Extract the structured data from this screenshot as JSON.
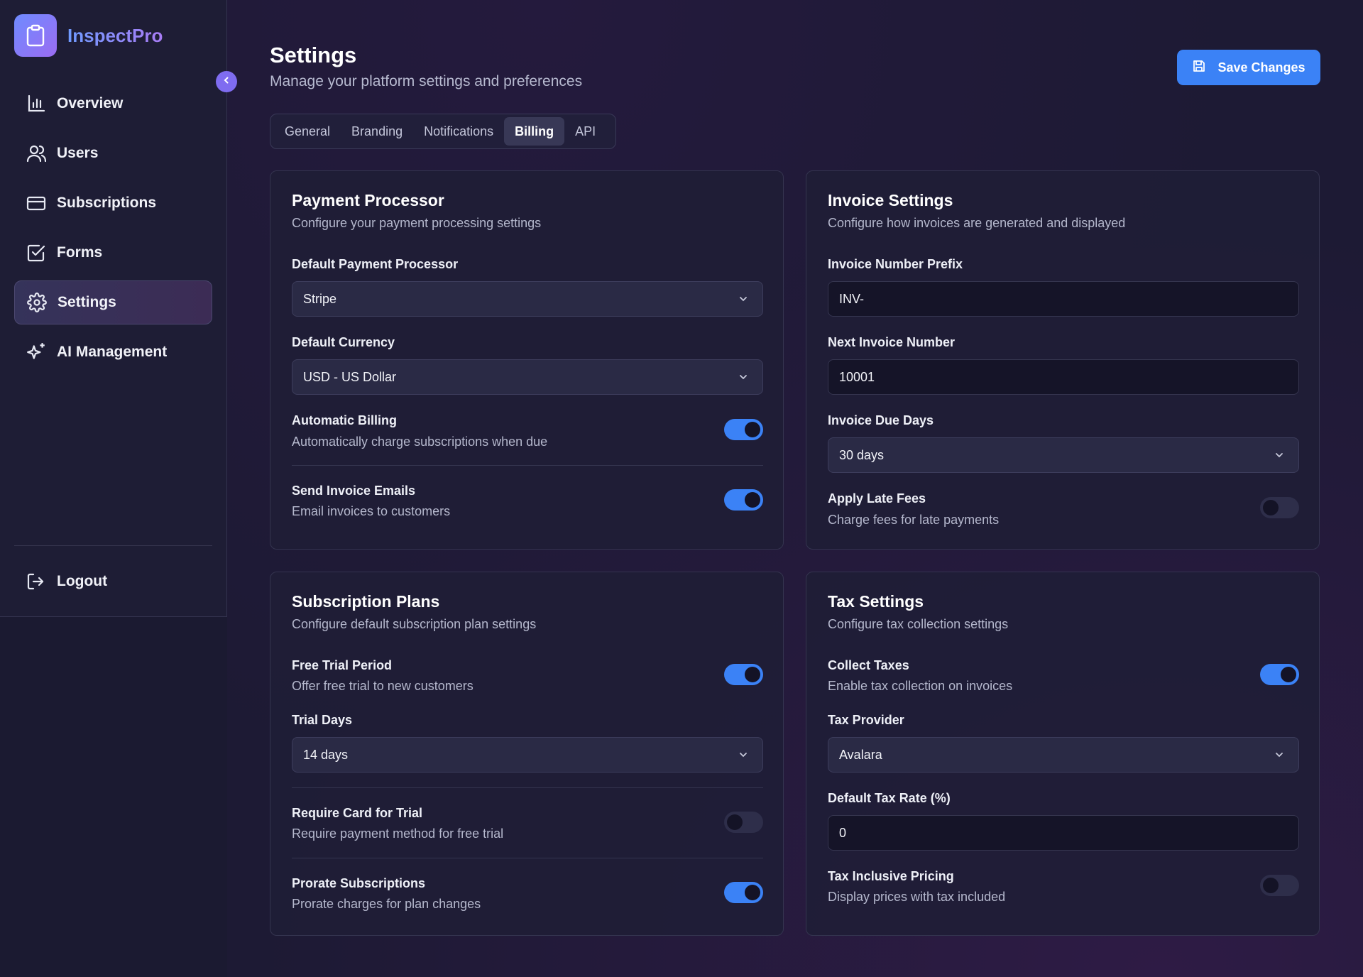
{
  "brand": {
    "name": "InspectPro"
  },
  "sidebar": {
    "items": [
      {
        "label": "Overview",
        "icon": "bar-chart-icon",
        "active": false
      },
      {
        "label": "Users",
        "icon": "users-icon",
        "active": false
      },
      {
        "label": "Subscriptions",
        "icon": "credit-card-icon",
        "active": false
      },
      {
        "label": "Forms",
        "icon": "checkbox-icon",
        "active": false
      },
      {
        "label": "Settings",
        "icon": "gear-icon",
        "active": true
      },
      {
        "label": "AI Management",
        "icon": "sparkles-icon",
        "active": false
      }
    ],
    "logout_label": "Logout"
  },
  "header": {
    "title": "Settings",
    "subtitle": "Manage your platform settings and preferences",
    "save_label": "Save Changes"
  },
  "tabs": [
    {
      "label": "General",
      "active": false
    },
    {
      "label": "Branding",
      "active": false
    },
    {
      "label": "Notifications",
      "active": false
    },
    {
      "label": "Billing",
      "active": true
    },
    {
      "label": "API",
      "active": false
    }
  ],
  "payment": {
    "title": "Payment Processor",
    "description": "Configure your payment processing settings",
    "processor_label": "Default Payment Processor",
    "processor_value": "Stripe",
    "currency_label": "Default Currency",
    "currency_value": "USD - US Dollar",
    "auto_billing": {
      "title": "Automatic Billing",
      "description": "Automatically charge subscriptions when due",
      "enabled": true
    },
    "invoice_emails": {
      "title": "Send Invoice Emails",
      "description": "Email invoices to customers",
      "enabled": true
    }
  },
  "invoice": {
    "title": "Invoice Settings",
    "description": "Configure how invoices are generated and displayed",
    "prefix_label": "Invoice Number Prefix",
    "prefix_value": "INV-",
    "next_label": "Next Invoice Number",
    "next_value": "10001",
    "due_label": "Invoice Due Days",
    "due_value": "30 days",
    "late_fees": {
      "title": "Apply Late Fees",
      "description": "Charge fees for late payments",
      "enabled": false
    }
  },
  "subscription": {
    "title": "Subscription Plans",
    "description": "Configure default subscription plan settings",
    "free_trial": {
      "title": "Free Trial Period",
      "description": "Offer free trial to new customers",
      "enabled": true
    },
    "trial_days_label": "Trial Days",
    "trial_days_value": "14 days",
    "require_card": {
      "title": "Require Card for Trial",
      "description": "Require payment method for free trial",
      "enabled": false
    },
    "prorate": {
      "title": "Prorate Subscriptions",
      "description": "Prorate charges for plan changes",
      "enabled": true
    }
  },
  "tax": {
    "title": "Tax Settings",
    "description": "Configure tax collection settings",
    "collect": {
      "title": "Collect Taxes",
      "description": "Enable tax collection on invoices",
      "enabled": true
    },
    "provider_label": "Tax Provider",
    "provider_value": "Avalara",
    "rate_label": "Default Tax Rate (%)",
    "rate_value": "0",
    "inclusive": {
      "title": "Tax Inclusive Pricing",
      "description": "Display prices with tax included",
      "enabled": false
    }
  },
  "colors": {
    "accent": "#3b82f6",
    "brand_gradient_start": "#6f8bff",
    "brand_gradient_end": "#9b6cf2"
  }
}
